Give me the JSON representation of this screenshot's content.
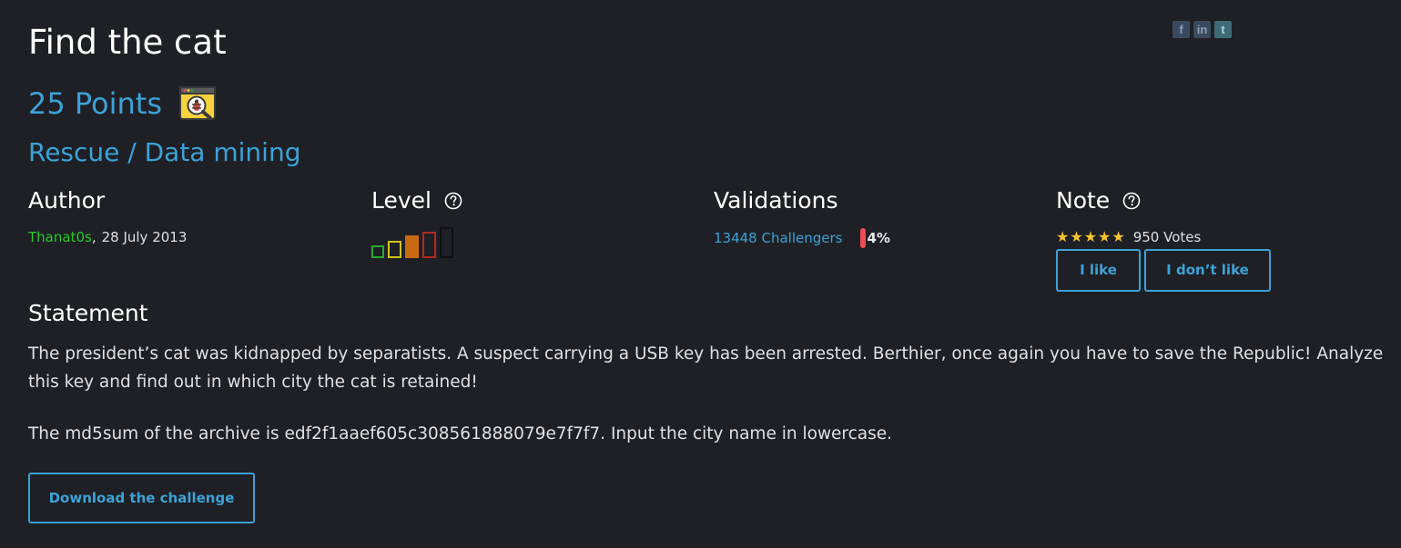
{
  "challenge": {
    "title": "Find the cat",
    "points": "25 Points",
    "category_icon": "bug-search-window-icon",
    "category": "Rescue / Data mining"
  },
  "share": {
    "items": [
      {
        "name": "facebook-icon",
        "glyph": "f"
      },
      {
        "name": "linkedin-icon",
        "glyph": "in"
      },
      {
        "name": "twitter-icon",
        "glyph": "t"
      }
    ]
  },
  "author": {
    "heading": "Author",
    "name": "Thanat0s",
    "separator": ",",
    "date": "28 July 2013"
  },
  "level": {
    "heading": "Level",
    "help_icon": "question-circle-icon",
    "current": 3,
    "max": 5,
    "colors": [
      "#2ea82e",
      "#d4c21c",
      "#c76a12",
      "#b02a1e",
      "#111111"
    ]
  },
  "validations": {
    "heading": "Validations",
    "challengers": "13448 Challengers",
    "percent": "4%",
    "bar_color": "#f24a52"
  },
  "note": {
    "heading": "Note",
    "help_icon": "question-circle-icon",
    "stars": 5,
    "votes": "950 Votes",
    "like_label": "I like",
    "dislike_label": "I don’t like"
  },
  "statement": {
    "heading": "Statement",
    "paragraph1": "The president’s cat was kidnapped by separatists. A suspect carrying a USB key has been arrested. Berthier, once again you have to save the Republic! Analyze this key and find out in which city the cat is retained!",
    "paragraph2": "The md5sum of the archive is edf2f1aaef605c308561888079e7f7f7. Input the city name in lowercase."
  },
  "download": {
    "label": "Download the challenge"
  },
  "colors": {
    "background": "#1e2026",
    "accent": "#3da2d6",
    "author": "#28c828",
    "star": "#f4c430"
  }
}
